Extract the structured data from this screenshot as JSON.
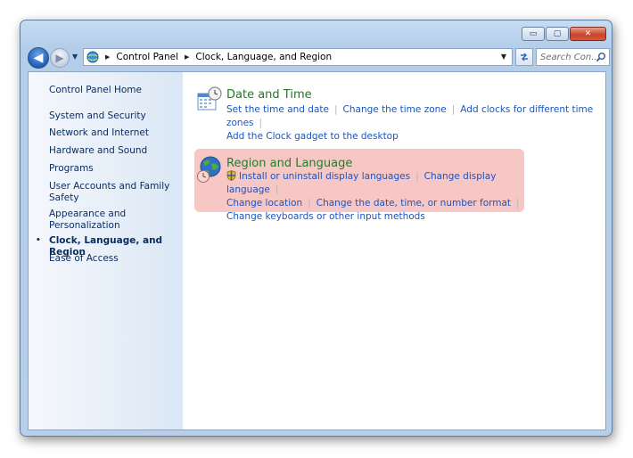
{
  "window": {
    "caption": {
      "minimize": "▭",
      "maximize": "▢",
      "close": "✕"
    }
  },
  "navbar": {
    "breadcrumbs": [
      "Control Panel",
      "Clock, Language, and Region"
    ],
    "search_placeholder": "Search Con..."
  },
  "sidebar": {
    "home": "Control Panel Home",
    "items": [
      "System and Security",
      "Network and Internet",
      "Hardware and Sound",
      "Programs",
      "User Accounts and Family Safety",
      "Appearance and Personalization",
      "Clock, Language, and Region",
      "Ease of Access"
    ],
    "current_index": 6,
    "bullet": "•"
  },
  "categories": [
    {
      "title": "Date and Time",
      "links": [
        "Set the time and date",
        "Change the time zone",
        "Add clocks for different time zones",
        "Add the Clock gadget to the desktop"
      ]
    },
    {
      "title": "Region and Language",
      "highlighted": true,
      "links": [
        "Install or uninstall display languages",
        "Change display language",
        "Change location",
        "Change the date, time, or number format",
        "Change keyboards or other input methods"
      ]
    }
  ],
  "colors": {
    "category_title": "#1e7b1e",
    "link": "#1a55c2",
    "highlight": "#f6c7c5",
    "sidebar_text": "#0b2d63"
  }
}
